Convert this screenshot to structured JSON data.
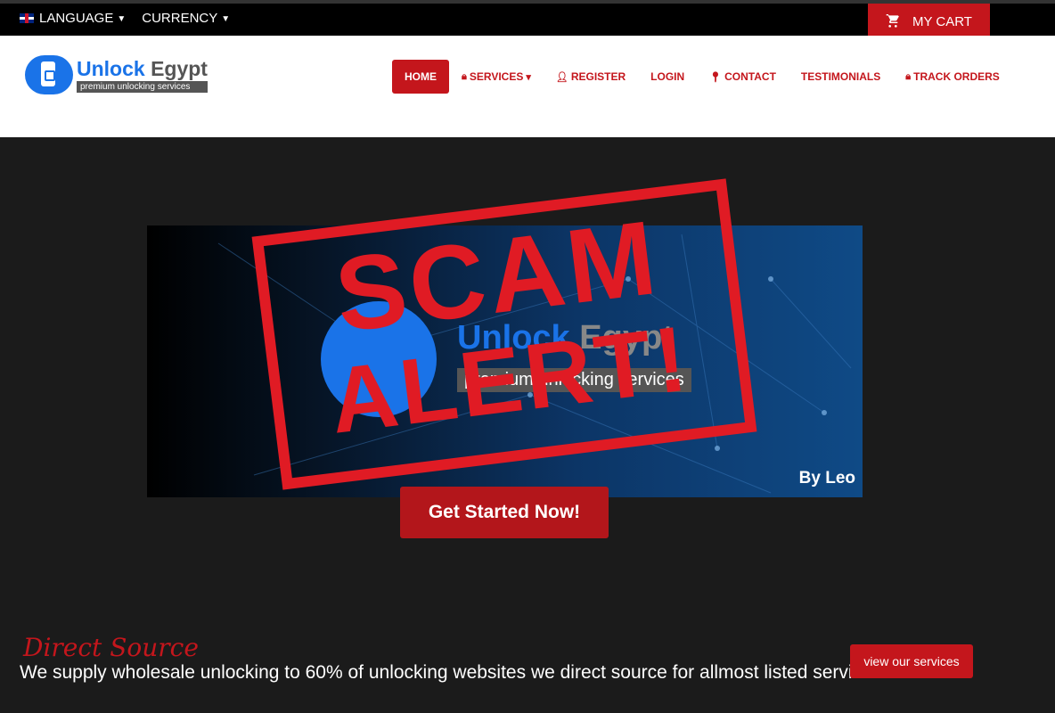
{
  "topbar": {
    "language_label": "LANGUAGE",
    "currency_label": "CURRENCY",
    "cart_label": "MY CART"
  },
  "logo": {
    "title_part1": "Unlock",
    "title_part2": "Egypt",
    "tagline": "premium unlocking services"
  },
  "nav": {
    "items": [
      {
        "label": "HOME",
        "icon": ""
      },
      {
        "label": "SERVICES",
        "icon": "lock-icon"
      },
      {
        "label": "REGISTER",
        "icon": "user-icon"
      },
      {
        "label": "LOGIN",
        "icon": ""
      },
      {
        "label": "CONTACT",
        "icon": "map-pin-icon"
      },
      {
        "label": "TESTIMONIALS",
        "icon": ""
      },
      {
        "label": "TRACK ORDERS",
        "icon": "lock-icon"
      }
    ]
  },
  "banner": {
    "stamp_line1": "SCAM",
    "stamp_line2": "ALERT!",
    "brand_part1": "Unlock",
    "brand_part2": "Egypt",
    "brand_tag": "premium unlocking services",
    "byline": "By Leo"
  },
  "hero": {
    "cta_label": "Get Started Now!"
  },
  "section": {
    "title": "Direct Source",
    "text": "We supply wholesale unlocking to 60% of unlocking websites we direct source for allmost listed services",
    "button_label": "view our services"
  },
  "colors": {
    "accent_red": "#c4161c",
    "brand_blue": "#1a73e8",
    "dark_bg": "#1b1b1b"
  }
}
